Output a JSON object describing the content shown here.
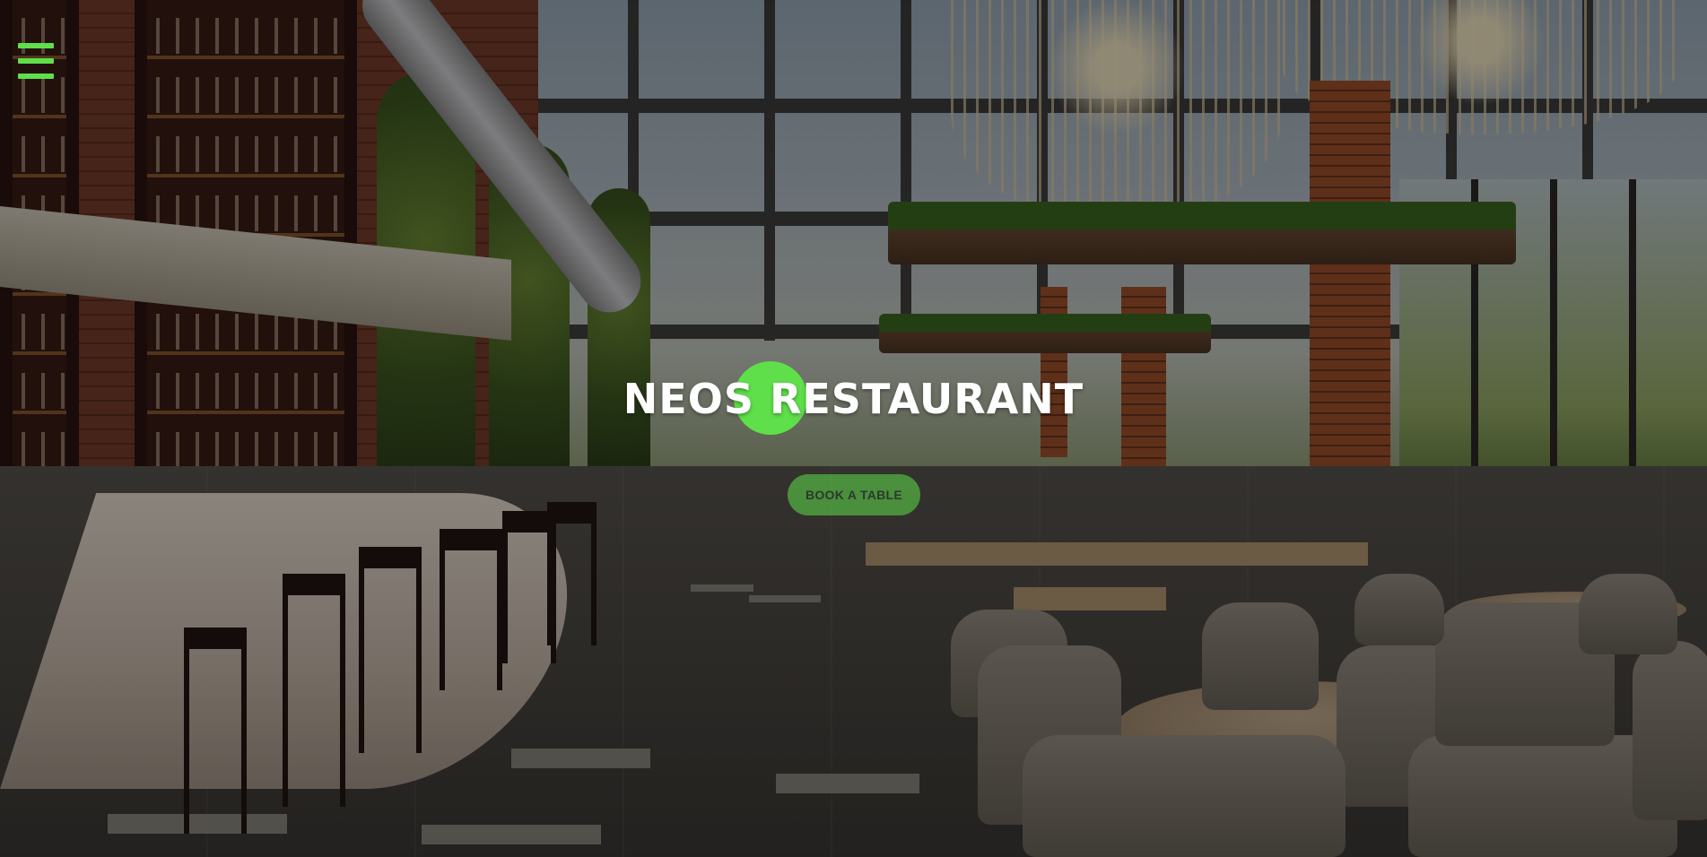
{
  "nav": {
    "menu_icon": "hamburger-menu-icon"
  },
  "hero": {
    "title": "NEOS RESTAURANT",
    "cta_label": "BOOK A TABLE"
  },
  "theme": {
    "accent": "#5fdf4a",
    "title_color": "#ffffff",
    "overlay": "rgba(0,0,0,0.42)"
  }
}
